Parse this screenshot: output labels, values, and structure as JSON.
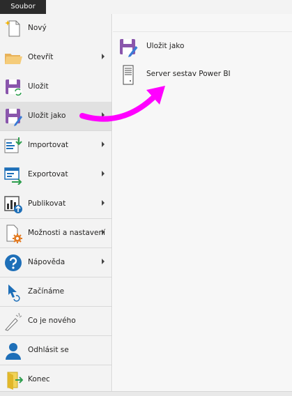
{
  "topbar": {
    "file_tab": "Soubor"
  },
  "menu": {
    "items": [
      {
        "label": "Nový",
        "icon": "new-file-icon"
      },
      {
        "label": "Otevřít",
        "icon": "folder-icon",
        "submenu": true
      },
      {
        "label": "Uložit",
        "icon": "save-icon"
      },
      {
        "label": "Uložit jako",
        "icon": "save-as-icon",
        "submenu": true,
        "active": true
      },
      {
        "label": "Importovat",
        "icon": "import-icon",
        "submenu": true
      },
      {
        "label": "Exportovat",
        "icon": "export-icon",
        "submenu": true
      },
      {
        "label": "Publikovat",
        "icon": "publish-icon",
        "submenu": true
      },
      {
        "label": "Možnosti a nastavení",
        "icon": "options-gear-icon",
        "submenu": true
      },
      {
        "label": "Nápověda",
        "icon": "help-icon",
        "submenu": true
      },
      {
        "label": "Začínáme",
        "icon": "getting-started-icon"
      },
      {
        "label": "Co je nového",
        "icon": "whats-new-icon"
      },
      {
        "label": "Odhlásit se",
        "icon": "user-icon"
      },
      {
        "label": "Konec",
        "icon": "exit-icon"
      }
    ]
  },
  "save_as_panel": {
    "items": [
      {
        "label": "Uložit jako",
        "icon": "save-as-icon"
      },
      {
        "label": "Server sestav Power BI",
        "icon": "server-icon"
      }
    ]
  },
  "colors": {
    "annotation_arrow": "#ff00ff",
    "save_purple": "#8a56ac",
    "accent_blue": "#1e6fb8"
  }
}
